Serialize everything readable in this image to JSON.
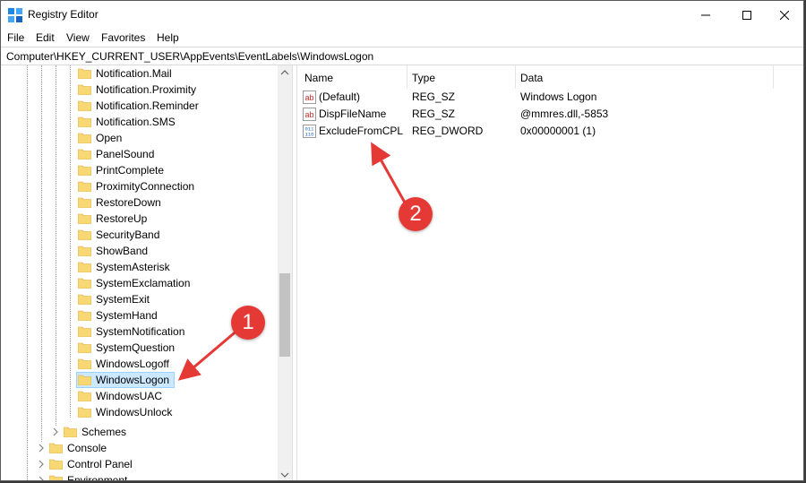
{
  "window": {
    "title": "Registry Editor",
    "icon": "registry-editor-icon",
    "controls": [
      "minimize-icon",
      "maximize-icon",
      "close-icon"
    ]
  },
  "menu": [
    "File",
    "Edit",
    "View",
    "Favorites",
    "Help"
  ],
  "address": "Computer\\HKEY_CURRENT_USER\\AppEvents\\EventLabels\\WindowsLogon",
  "tree": {
    "child_items": [
      "Notification.Mail",
      "Notification.Proximity",
      "Notification.Reminder",
      "Notification.SMS",
      "Open",
      "PanelSound",
      "PrintComplete",
      "ProximityConnection",
      "RestoreDown",
      "RestoreUp",
      "SecurityBand",
      "ShowBand",
      "SystemAsterisk",
      "SystemExclamation",
      "SystemExit",
      "SystemHand",
      "SystemNotification",
      "SystemQuestion",
      "WindowsLogoff",
      "WindowsLogon",
      "WindowsUAC",
      "WindowsUnlock"
    ],
    "selected": "WindowsLogon",
    "schemes": "Schemes",
    "root_items": [
      "Console",
      "Control Panel",
      "Environment"
    ]
  },
  "list": {
    "headers": {
      "name": "Name",
      "type": "Type",
      "data": "Data"
    },
    "rows": [
      {
        "icon": "string-value-icon",
        "name": "(Default)",
        "type": "REG_SZ",
        "data": "Windows Logon"
      },
      {
        "icon": "string-value-icon",
        "name": "DispFileName",
        "type": "REG_SZ",
        "data": "@mmres.dll,-5853"
      },
      {
        "icon": "dword-value-icon",
        "name": "ExcludeFromCPL",
        "type": "REG_DWORD",
        "data": "0x00000001 (1)"
      }
    ]
  },
  "callouts": [
    "1",
    "2"
  ],
  "colors": {
    "selection_bg": "#cce8ff",
    "callout_red": "#e53935",
    "folder_yellow": "#f8d775"
  }
}
